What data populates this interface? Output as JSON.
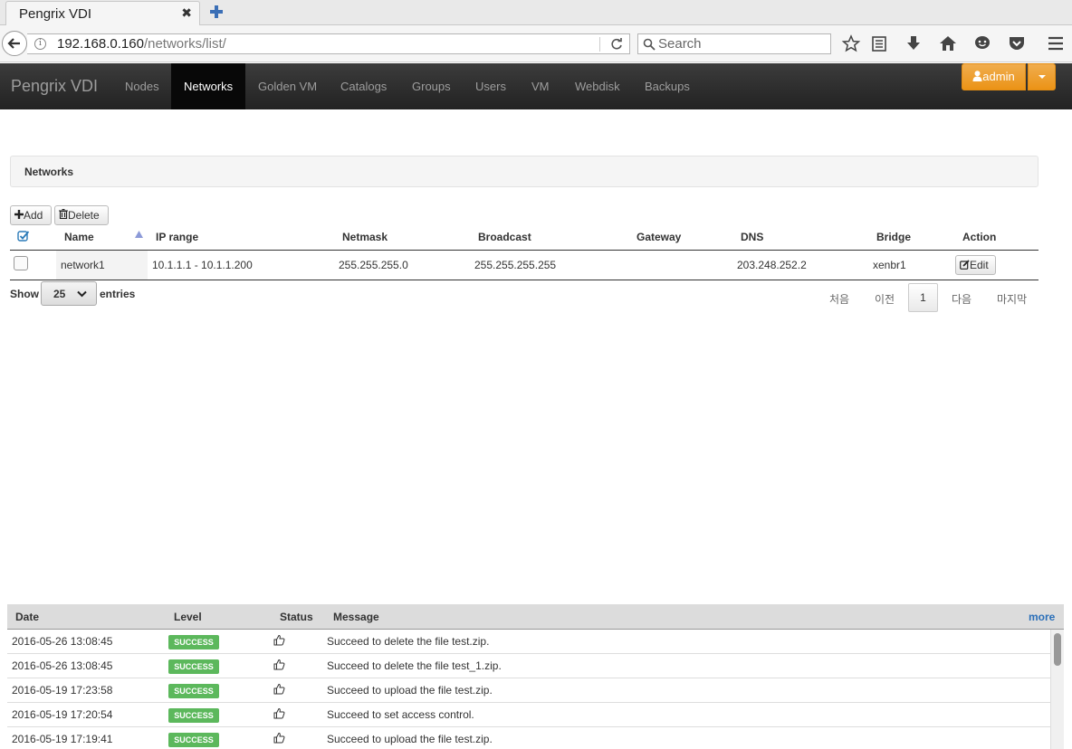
{
  "browser": {
    "tab_title": "Pengrix VDI",
    "url_host": "192.168.0.160",
    "url_path": "/networks/list/",
    "search_placeholder": "Search"
  },
  "app": {
    "brand": "Pengrix VDI",
    "nav": [
      "Nodes",
      "Networks",
      "Golden VM",
      "Catalogs",
      "Groups",
      "Users",
      "VM",
      "Webdisk",
      "Backups"
    ],
    "active_nav": "Networks",
    "user": "admin"
  },
  "page": {
    "panel_title": "Networks",
    "add_label": "Add",
    "delete_label": "Delete"
  },
  "table": {
    "headers": [
      "Name",
      "IP range",
      "Netmask",
      "Broadcast",
      "Gateway",
      "DNS",
      "Bridge",
      "Action"
    ],
    "rows": [
      {
        "name": "network1",
        "ip_range": "10.1.1.1 - 10.1.1.200",
        "netmask": "255.255.255.0",
        "broadcast": "255.255.255.255",
        "gateway": "",
        "dns": "203.248.252.2",
        "bridge": "xenbr1",
        "action": "Edit"
      }
    ]
  },
  "pagination": {
    "show_label": "Show",
    "page_size": "25",
    "entries_label": "entries",
    "first": "처음",
    "prev": "이전",
    "current": "1",
    "next": "다음",
    "last": "마지막"
  },
  "log": {
    "headers": [
      "Date",
      "Level",
      "Status",
      "Message"
    ],
    "more_label": "more",
    "rows": [
      {
        "date": "2016-05-26 13:08:45",
        "level": "SUCCESS",
        "message": "Succeed to delete the file test.zip."
      },
      {
        "date": "2016-05-26 13:08:45",
        "level": "SUCCESS",
        "message": "Succeed to delete the file test_1.zip."
      },
      {
        "date": "2016-05-19 17:23:58",
        "level": "SUCCESS",
        "message": "Succeed to upload the file test.zip."
      },
      {
        "date": "2016-05-19 17:20:54",
        "level": "SUCCESS",
        "message": "Succeed to set access control."
      },
      {
        "date": "2016-05-19 17:19:41",
        "level": "SUCCESS",
        "message": "Succeed to upload the file test.zip."
      }
    ]
  },
  "colors": {
    "navbar_bg": "#222222",
    "admin_button": "#f0ad4e",
    "success_badge": "#5cb85c",
    "more_link": "#2a6fb8"
  }
}
